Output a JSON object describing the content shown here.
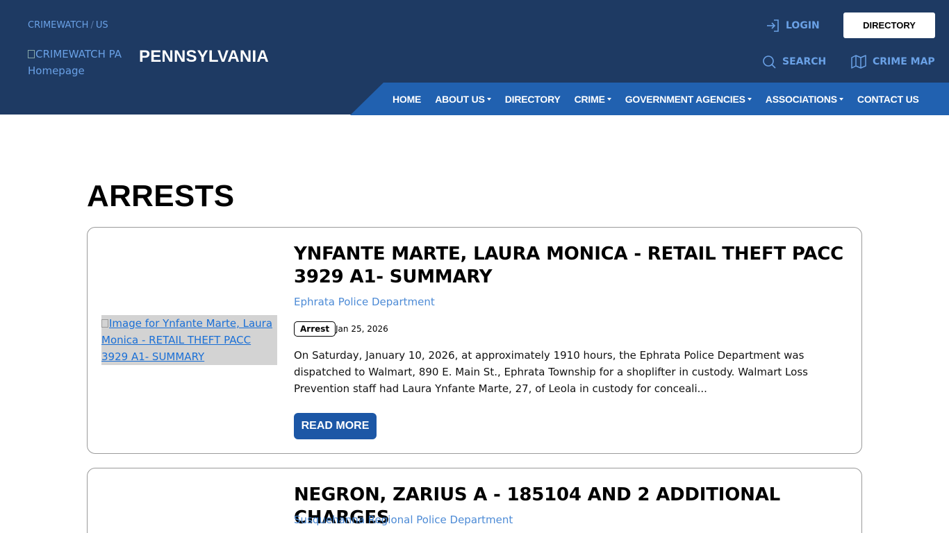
{
  "header": {
    "breadcrumb": {
      "root": "CRIMEWATCH",
      "separator": "/",
      "current": "US"
    },
    "logo_alt": "CRIMEWATCH PA Homepage",
    "state_name": "PENNSYLVANIA",
    "login_label": "LOGIN",
    "directory_button": "DIRECTORY",
    "search_label": "SEARCH",
    "crime_map_label": "CRIME MAP",
    "colors": {
      "header_bg": "#1e3a63",
      "nav_bg": "#2161b0",
      "link": "#6aa1e6"
    }
  },
  "nav": {
    "items": [
      {
        "label": "HOME",
        "dropdown": false
      },
      {
        "label": "ABOUT US",
        "dropdown": true
      },
      {
        "label": "DIRECTORY",
        "dropdown": false
      },
      {
        "label": "CRIME",
        "dropdown": true
      },
      {
        "label": "GOVERNMENT AGENCIES",
        "dropdown": true
      },
      {
        "label": "ASSOCIATIONS",
        "dropdown": true
      },
      {
        "label": "CONTACT US",
        "dropdown": false
      }
    ]
  },
  "main": {
    "page_title": "ARRESTS",
    "articles": [
      {
        "image_alt": "Image for Ynfante Marte, Laura Monica - RETAIL THEFT PACC 3929 A1- SUMMARY",
        "title": "YNFANTE MARTE, LAURA MONICA - RETAIL THEFT PACC 3929 A1- SUMMARY",
        "agency": "Ephrata Police Department",
        "badge": "Arrest",
        "date": "Jan 25, 2026",
        "excerpt": "On Saturday, January 10, 2026, at approximately 1910 hours, the Ephrata Police Department was dispatched to Walmart, 890 E. Main St., Ephrata Township for a shoplifter in custody.  Walmart Loss Prevention staff had Laura Ynfante Marte, 27, of Leola in custody for conceali...",
        "read_more": "READ MORE"
      },
      {
        "title": "NEGRON, ZARIUS A - 185104 AND 2 ADDITIONAL CHARGES",
        "agency": "Susquehanna Regional Police Department"
      }
    ],
    "colors": {
      "agency_link": "#4d8bd6",
      "button_bg": "#1c57a6"
    }
  }
}
